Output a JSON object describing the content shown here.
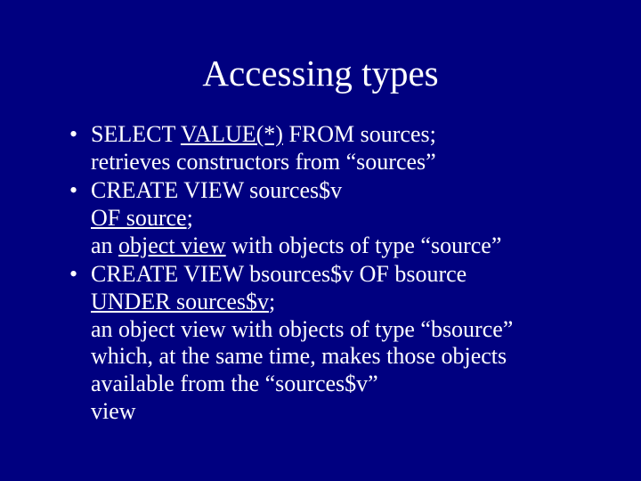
{
  "title": "Accessing types",
  "bullets": [
    {
      "mark": "•",
      "segments": [
        {
          "t": "SELECT ",
          "u": false
        },
        {
          "t": "VALUE(*)",
          "u": true
        },
        {
          "t": " FROM sources;\nretrieves constructors from “sources”",
          "u": false
        }
      ]
    },
    {
      "mark": "•",
      "segments": [
        {
          "t": "CREATE VIEW sources$v\n",
          "u": false
        },
        {
          "t": "OF source",
          "u": true
        },
        {
          "t": ";\nan ",
          "u": false
        },
        {
          "t": "object view",
          "u": true
        },
        {
          "t": " with objects of type “source”",
          "u": false
        }
      ]
    },
    {
      "mark": "•",
      "segments": [
        {
          "t": "CREATE VIEW bsources$v OF bsource\n",
          "u": false
        },
        {
          "t": "UNDER sources$v",
          "u": true
        },
        {
          "t": ";\nan object view with objects of type “bsource”\nwhich, at the same time, makes those objects\navailable from the “sources$v”\nview",
          "u": false
        }
      ]
    }
  ]
}
